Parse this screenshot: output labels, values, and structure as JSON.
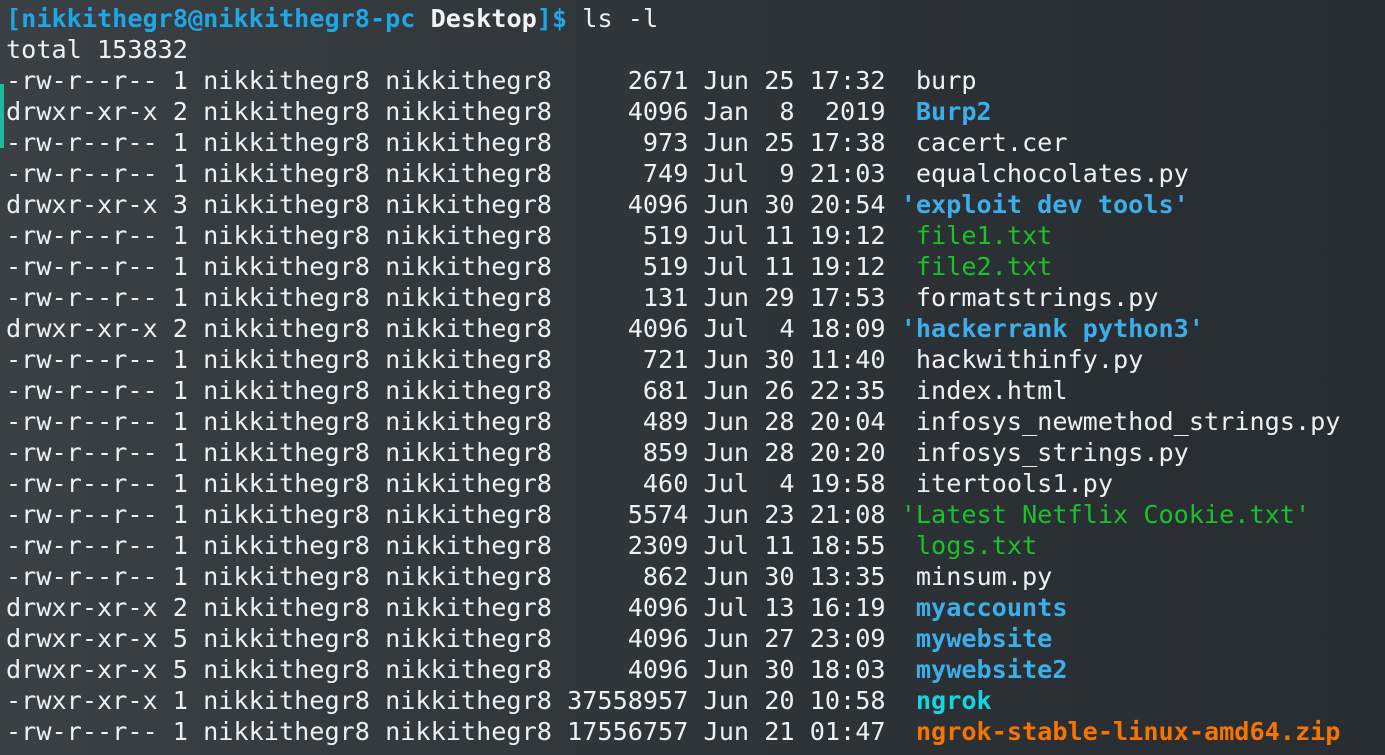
{
  "prompt": {
    "open_bracket": "[",
    "user_host": "nikkithegr8@nikkithegr8-pc",
    "directory": "Desktop",
    "close_symbol": "]$",
    "command": "ls -l"
  },
  "total_line": "total 153832",
  "colors": {
    "directory": "#3daee9",
    "text_file": "#19c22a",
    "executable": "#14d6e0",
    "archive": "#f67400",
    "regular": "#eef0f2"
  },
  "entries": [
    {
      "meta": "-rw-r--r-- 1 nikkithegr8 nikkithegr8     2671 Jun 25 17:32  ",
      "name": "burp",
      "kind": "file"
    },
    {
      "meta": "drwxr-xr-x 2 nikkithegr8 nikkithegr8     4096 Jan  8  2019  ",
      "name": "Burp2",
      "kind": "dir"
    },
    {
      "meta": "-rw-r--r-- 1 nikkithegr8 nikkithegr8      973 Jun 25 17:38  ",
      "name": "cacert.cer",
      "kind": "file"
    },
    {
      "meta": "-rw-r--r-- 1 nikkithegr8 nikkithegr8      749 Jul  9 21:03  ",
      "name": "equalchocolates.py",
      "kind": "file"
    },
    {
      "meta": "drwxr-xr-x 3 nikkithegr8 nikkithegr8     4096 Jun 30 20:54 ",
      "name": "'exploit dev tools'",
      "kind": "dir"
    },
    {
      "meta": "-rw-r--r-- 1 nikkithegr8 nikkithegr8      519 Jul 11 19:12  ",
      "name": "file1.txt",
      "kind": "text"
    },
    {
      "meta": "-rw-r--r-- 1 nikkithegr8 nikkithegr8      519 Jul 11 19:12  ",
      "name": "file2.txt",
      "kind": "text"
    },
    {
      "meta": "-rw-r--r-- 1 nikkithegr8 nikkithegr8      131 Jun 29 17:53  ",
      "name": "formatstrings.py",
      "kind": "file"
    },
    {
      "meta": "drwxr-xr-x 2 nikkithegr8 nikkithegr8     4096 Jul  4 18:09 ",
      "name": "'hackerrank python3'",
      "kind": "dir"
    },
    {
      "meta": "-rw-r--r-- 1 nikkithegr8 nikkithegr8      721 Jun 30 11:40  ",
      "name": "hackwithinfy.py",
      "kind": "file"
    },
    {
      "meta": "-rw-r--r-- 1 nikkithegr8 nikkithegr8      681 Jun 26 22:35  ",
      "name": "index.html",
      "kind": "file"
    },
    {
      "meta": "-rw-r--r-- 1 nikkithegr8 nikkithegr8      489 Jun 28 20:04  ",
      "name": "infosys_newmethod_strings.py",
      "kind": "file"
    },
    {
      "meta": "-rw-r--r-- 1 nikkithegr8 nikkithegr8      859 Jun 28 20:20  ",
      "name": "infosys_strings.py",
      "kind": "file"
    },
    {
      "meta": "-rw-r--r-- 1 nikkithegr8 nikkithegr8      460 Jul  4 19:58  ",
      "name": "itertools1.py",
      "kind": "file"
    },
    {
      "meta": "-rw-r--r-- 1 nikkithegr8 nikkithegr8     5574 Jun 23 21:08 ",
      "name": "'Latest Netflix Cookie.txt'",
      "kind": "text"
    },
    {
      "meta": "-rw-r--r-- 1 nikkithegr8 nikkithegr8     2309 Jul 11 18:55  ",
      "name": "logs.txt",
      "kind": "text"
    },
    {
      "meta": "-rw-r--r-- 1 nikkithegr8 nikkithegr8      862 Jun 30 13:35  ",
      "name": "minsum.py",
      "kind": "file"
    },
    {
      "meta": "drwxr-xr-x 2 nikkithegr8 nikkithegr8     4096 Jul 13 16:19  ",
      "name": "myaccounts",
      "kind": "dir"
    },
    {
      "meta": "drwxr-xr-x 5 nikkithegr8 nikkithegr8     4096 Jun 27 23:09  ",
      "name": "mywebsite",
      "kind": "dir"
    },
    {
      "meta": "drwxr-xr-x 5 nikkithegr8 nikkithegr8     4096 Jun 30 18:03  ",
      "name": "mywebsite2",
      "kind": "dir"
    },
    {
      "meta": "-rwxr-xr-x 1 nikkithegr8 nikkithegr8 37558957 Jun 20 10:58  ",
      "name": "ngrok",
      "kind": "exec"
    },
    {
      "meta": "-rw-r--r-- 1 nikkithegr8 nikkithegr8 17556757 Jun 21 01:47  ",
      "name": "ngrok-stable-linux-amd64.zip",
      "kind": "archive"
    }
  ]
}
